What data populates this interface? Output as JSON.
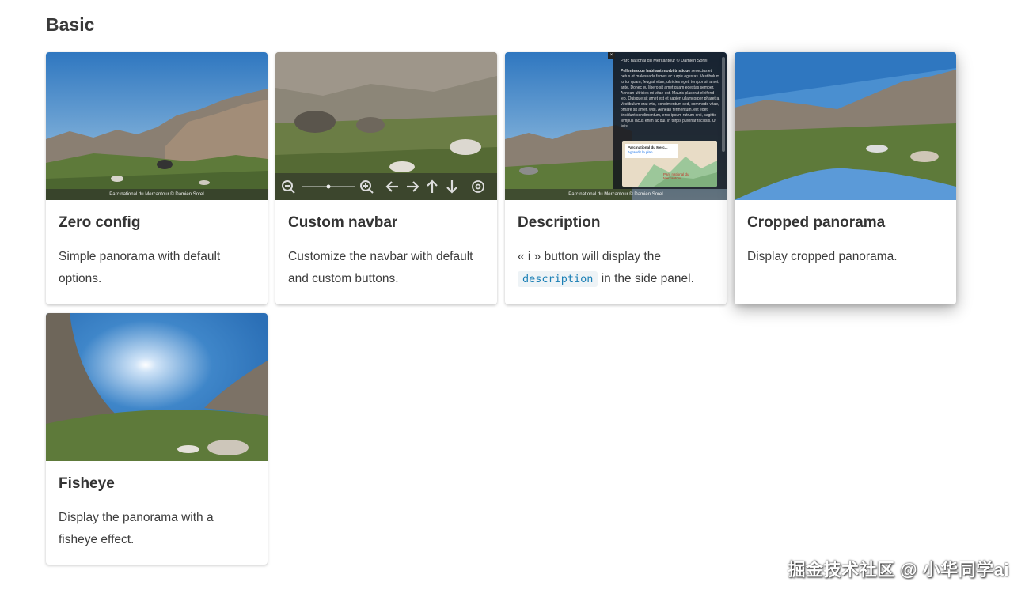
{
  "section": {
    "title": "Basic"
  },
  "cards": [
    {
      "title": "Zero config",
      "description": "Simple panorama with default options.",
      "navbar_caption": "Parc national du Mercantour © Damien Sorel"
    },
    {
      "title": "Custom navbar",
      "description": "Customize the navbar with default and custom buttons."
    },
    {
      "title": "Description",
      "desc_before": "« i » button will display the",
      "desc_code": "description",
      "desc_after": "in the side panel.",
      "navbar_caption": "Parc national du Mercantour © Damien Sorel",
      "panel_heading": "Parc national du Mercantour © Damien Sorel",
      "panel_bold": "Pellentesque habitant morbi tristique",
      "panel_text": "senectus et netus et malesuada fames ac turpis egestas. Vestibulum tortor quam, feugiat vitae, ultricies eget, tempor sit amet, ante. Donec eu libero sit amet quam egestas semper. Aenean ultricies mi vitae est. Mauris placerat eleifend leo. Quisque sit amet est et sapien ullamcorper pharetra. Vestibulum erat wisi, condimentum sed, commodo vitae, ornare sit amet, wisi. Aenean fermentum, elit eget tincidunt condimentum, eros ipsum rutrum orci, sagittis tempus lacus enim ac dui. in turpis pulvinar facilisis. Ut felis.",
      "map_popup_title": "Parc national du Merc...",
      "map_popup_link": "Agrandir le plan",
      "map_label": "Parc national du Mercantour"
    },
    {
      "title": "Cropped panorama",
      "description": "Display cropped panorama."
    },
    {
      "title": "Fisheye",
      "description": "Display the panorama with a fisheye effect."
    }
  ],
  "watermark": "掘金技术社区 @ 小华同学ai",
  "colors": {
    "code_text": "#1a7fb5",
    "code_bg": "#eef3f6",
    "sky": "#3f86c9"
  }
}
